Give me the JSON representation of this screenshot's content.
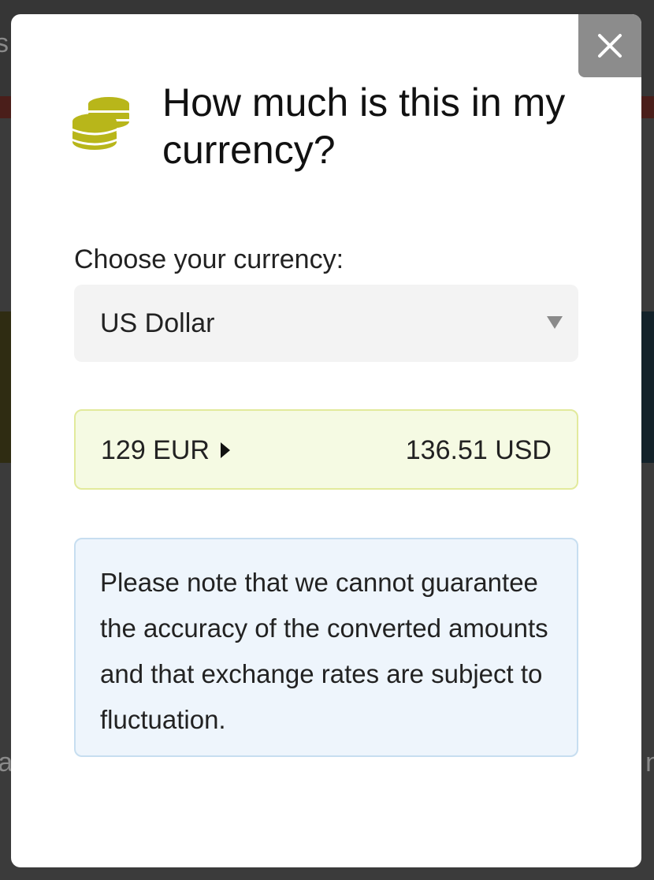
{
  "modal": {
    "title": "How much is this in my currency?",
    "close_icon": "close-icon",
    "coin_icon": "coins-icon",
    "coin_color": "#b8b61a",
    "currency_label": "Choose your currency:",
    "currency_select": {
      "selected": "US Dollar"
    },
    "conversion": {
      "from": "129 EUR",
      "to": "136.51 USD"
    },
    "note": "Please note that we cannot guarantee the accuracy of the converted amounts and that exchange rates are subject to fluctuation."
  },
  "background": {
    "left_fragment_top": "s",
    "left_fragment_bottom": "ra",
    "right_fragment_bottom": "n"
  }
}
